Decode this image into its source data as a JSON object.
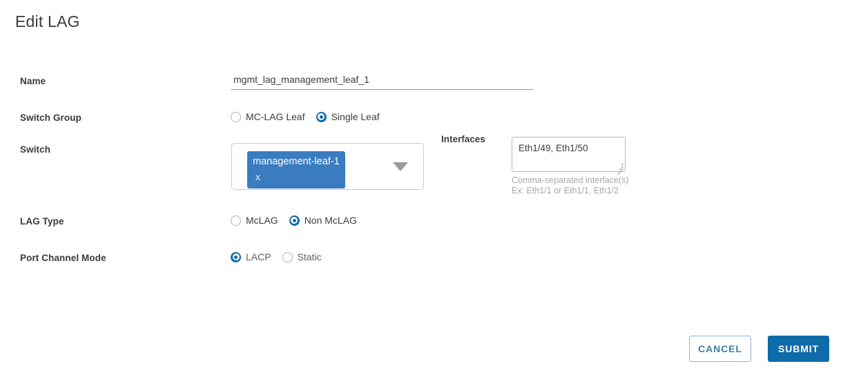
{
  "dialog": {
    "title": "Edit LAG"
  },
  "form": {
    "name": {
      "label": "Name",
      "value": "mgmt_lag_management_leaf_1",
      "placeholder": ""
    },
    "switch_group": {
      "label": "Switch Group",
      "options": [
        {
          "label": "MC-LAG Leaf",
          "selected": false
        },
        {
          "label": "Single Leaf",
          "selected": true
        }
      ],
      "selected_value": "Single Leaf"
    },
    "switch": {
      "label": "Switch",
      "chips": [
        {
          "label": "management-leaf-1",
          "remove_glyph": "x"
        }
      ]
    },
    "interfaces": {
      "label": "Interfaces",
      "value": "Eth1/49, Eth1/50",
      "placeholder": "",
      "help_line_1": "Comma-separated interface(s)",
      "help_line_2": "Ex: Eth1/1 or Eth1/1, Eth1/2"
    },
    "lag_type": {
      "label": "LAG Type",
      "options": [
        {
          "label": "McLAG",
          "selected": false
        },
        {
          "label": "Non McLAG",
          "selected": true
        }
      ],
      "selected_value": "Non McLAG"
    },
    "port_channel_mode": {
      "label": "Port Channel Mode",
      "options": [
        {
          "label": "LACP",
          "selected": true
        },
        {
          "label": "Static",
          "selected": false
        }
      ],
      "selected_value": "LACP"
    }
  },
  "footer": {
    "cancel_label": "CANCEL",
    "submit_label": "SUBMIT"
  },
  "colors": {
    "accent_blue": "#0f6ca8",
    "chip_blue": "#3b7cc0",
    "cancel_border": "#8ab7d6",
    "cancel_text": "#3d7fa6",
    "help_text": "#a8a8a8"
  }
}
